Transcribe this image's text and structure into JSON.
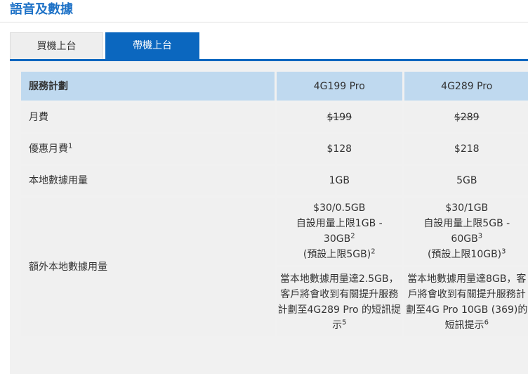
{
  "page": {
    "title": "語音及數據"
  },
  "tabs": [
    {
      "label": "買機上台",
      "active": false
    },
    {
      "label": "帶機上台",
      "active": true
    }
  ],
  "colors": {
    "accent": "#0b67bf",
    "title": "#1e72c7",
    "header_bg": "#bfd9ef",
    "cell_bg": "#f0f0f0"
  },
  "table": {
    "header": {
      "label": "服務計劃",
      "plan_a": "4G199 Pro",
      "plan_b": "4G289 Pro"
    },
    "monthly_fee": {
      "label": "月費",
      "plan_a": "$199",
      "plan_b": "$289"
    },
    "discount_fee": {
      "label": "優惠月費",
      "sup": "1",
      "plan_a": "$128",
      "plan_b": "$218"
    },
    "local_data": {
      "label": "本地數據用量",
      "plan_a": "1GB",
      "plan_b": "5GB"
    },
    "extra_data": {
      "label": "額外本地數據用量",
      "plan_a": {
        "price": "$30/0.5GB",
        "limit": "自設用量上限1GB -",
        "limit_end": "30GB",
        "limit_sup": "2",
        "default": "(預設上限5GB)",
        "default_sup": "2",
        "notice": "當本地數據用量達2.5GB，客戶將會收到有關提升服務計劃至4G289 Pro 的短訊提示",
        "notice_sup": "5"
      },
      "plan_b": {
        "price": "$30/1GB",
        "limit": "自設用量上限5GB -",
        "limit_end": "60GB",
        "limit_sup": "3",
        "default": "(預設上限10GB)",
        "default_sup": "3",
        "notice": "當本地數據用量達8GB，客戶將會收到有關提升服務計劃至4G Pro 10GB (369)的短訊提示",
        "notice_sup": "6"
      }
    }
  }
}
